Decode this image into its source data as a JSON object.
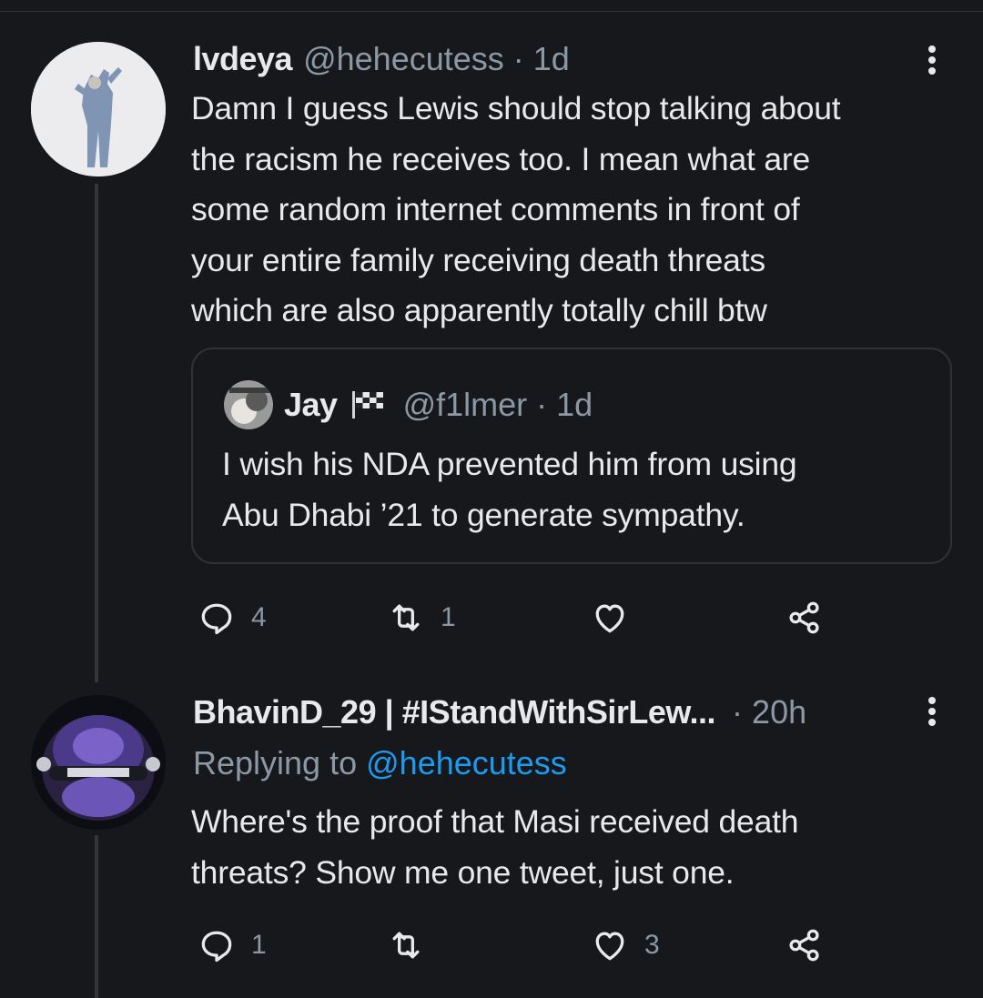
{
  "tweets": [
    {
      "display_name": "lvdeya",
      "handle": "@hehecutess",
      "time": "1d",
      "text": "Damn I guess Lewis should stop talking about\nthe racism he receives too. I mean what are\nsome random internet comments in front of\nyour entire family receiving death threats\nwhich are also apparently totally chill btw",
      "quote": {
        "display_name": "Jay",
        "flag_icon": "checkered-flag-icon",
        "handle": "@f1lmer",
        "time": "1d",
        "text": "I wish his NDA prevented him from using\nAbu Dhabi ’21 to generate sympathy."
      },
      "actions": {
        "replies": "4",
        "retweets": "1",
        "likes": ""
      }
    },
    {
      "display_name": "BhavinD_29 | #IStandWithSirLew...",
      "time": "20h",
      "replying_prefix": "Replying to",
      "replying_to": "@hehecutess",
      "text": "Where's the proof that Masi received death\nthreats? Show me one tweet, just one.",
      "actions": {
        "replies": "1",
        "retweets": "",
        "likes": "3"
      }
    }
  ],
  "separator": "·",
  "colors": {
    "background": "#16181b",
    "text": "#e7e9ea",
    "secondary": "#8b98a5",
    "link": "#1d9bf0",
    "border": "#2f3336"
  }
}
